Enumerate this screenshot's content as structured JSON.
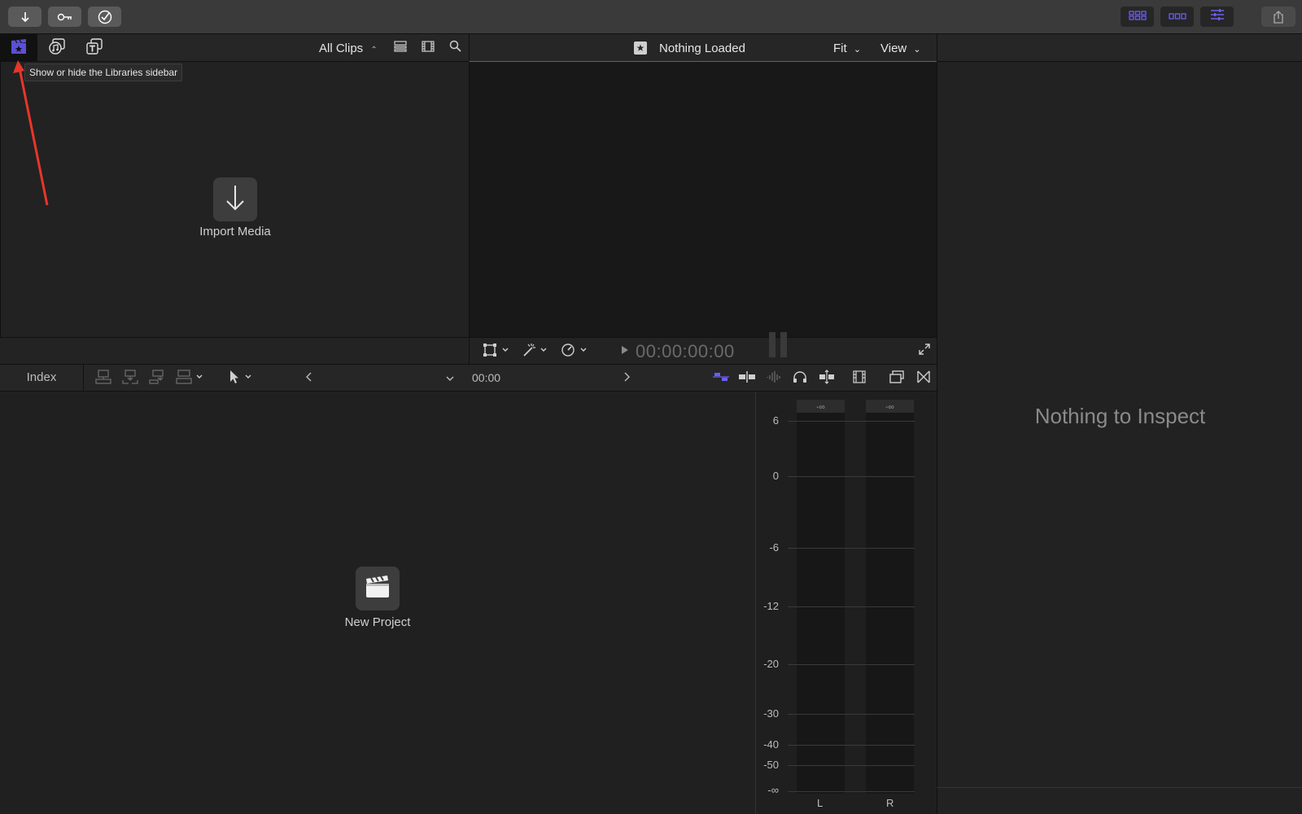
{
  "toolbar": {
    "import_icon": "arrow-down-icon",
    "keyword_icon": "key-icon",
    "background_tasks_icon": "checkmark-circle-icon",
    "view_buttons": [
      "browser-layout-icon",
      "timeline-layout-icon",
      "inspector-layout-icon"
    ],
    "share_icon": "share-icon",
    "accent_color": "#5b4fd6"
  },
  "browser": {
    "tabs": [
      "libraries-icon",
      "photos-audio-icon",
      "titles-generators-icon"
    ],
    "tooltip": "Show or hide the Libraries sidebar",
    "filter_label": "All Clips",
    "import_label": "Import Media"
  },
  "viewer": {
    "title": "Nothing Loaded",
    "fit_label": "Fit",
    "view_label": "View",
    "timecode": "00:00:00:00"
  },
  "inspector": {
    "empty_label": "Nothing to Inspect"
  },
  "timeline": {
    "index_label": "Index",
    "timecode": "00:00",
    "new_project_label": "New Project"
  },
  "audio_meters": {
    "peak_left": "-∞",
    "peak_right": "-∞",
    "scale": [
      "6",
      "0",
      "-6",
      "-12",
      "-20",
      "-30",
      "-40",
      "-50",
      "-∞"
    ],
    "channel_left": "L",
    "channel_right": "R"
  }
}
